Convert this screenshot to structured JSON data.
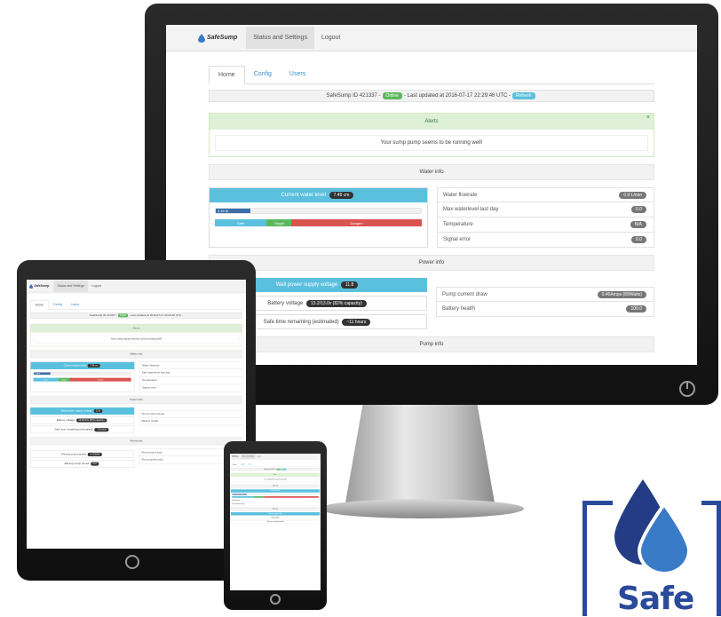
{
  "app": {
    "brand": "SafeSump",
    "nav": {
      "active": "Status and Settings",
      "logout": "Logout"
    },
    "tabs": [
      "Home",
      "Config",
      "Users"
    ],
    "id_bar": {
      "prefix": "SafeSump ID 421337 -",
      "status_badge": "Online",
      "updated": "- Last updated at 2016-07-17 22:29:48 UTC -",
      "refresh_button": "Refresh"
    },
    "alerts": {
      "title": "Alerts",
      "close": "×",
      "message": "Your sump pump seems to be running well!"
    },
    "water_info": {
      "title": "Water info",
      "current_level_label": "Current water level",
      "current_level_value": "7.49 cm",
      "bar_label": "2.49 lb",
      "bar_fraction": 0.17,
      "zones": {
        "safe": "Safe",
        "target": "Target",
        "danger": "Danger!"
      },
      "stats": [
        {
          "label": "Water flowrate",
          "value": "0.0 L/min"
        },
        {
          "label": "Max waterlevel last day",
          "value": "0.0"
        },
        {
          "label": "Temperature",
          "value": "N/A"
        },
        {
          "label": "Signal error",
          "value": "0.0"
        }
      ]
    },
    "power_info": {
      "title": "Power info",
      "wall_label": "Wall power supply voltage",
      "wall_value": "11.8",
      "battery_label": "Battery voltage",
      "battery_value": "13.2/13.0v (82% capacity)",
      "safe_time_label": "Safe time remaining (estimated)",
      "safe_time_value": "~11 hours",
      "pump_draw_label": "Pump current draw",
      "pump_draw_value": "0.46Amps (89Watts)",
      "battery_health_label": "Battery health",
      "battery_health_value": "100.0"
    },
    "pump_info": {
      "title": "Pump info",
      "primary_label": "Primary pump speed",
      "primary_value": "1/ 200000",
      "backup_label": "Backup pump speed",
      "backup_value": "0/ 0",
      "hours_label": "Pump hours total",
      "cycles_label": "Pump cycles total"
    }
  },
  "logo": {
    "text": "Safe",
    "color": "#2a4a9a",
    "drop_dark": "#233c85",
    "drop_light": "#3a7bc8"
  },
  "colors": {
    "info": "#5bc0de",
    "success": "#5cb85c",
    "danger": "#d9534f",
    "bar": "#3a6ea8"
  }
}
